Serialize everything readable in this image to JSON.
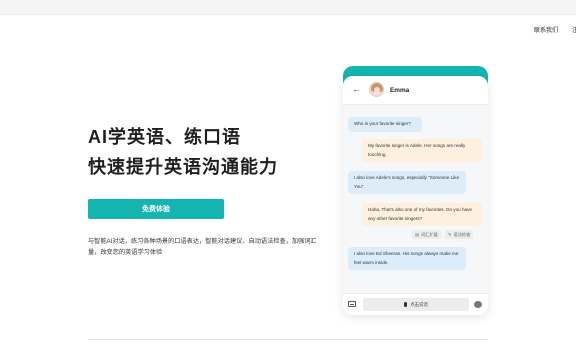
{
  "nav": {
    "contact": "联系我们",
    "edge": "注"
  },
  "hero": {
    "title_line1": "AI学英语、练口语",
    "title_line2": "快速提升英语沟通能力",
    "cta": "免费体验",
    "description": "与智能AI对话，练习各种场景的口语表达，智能对话建议、自动语法检查，加强词汇量，改变您的英语学习体验"
  },
  "chat": {
    "contact_name": "Emma",
    "messages": [
      {
        "role": "bot",
        "text": "Who is your favorite singer?"
      },
      {
        "role": "user",
        "text": "My favorite singer is Adele. Her songs are really touching."
      },
      {
        "role": "bot",
        "text": "I also love Adele's songs, especially \"Someone Like You\"."
      },
      {
        "role": "user",
        "text": "Haha, That's also one of my favorites. Do you have any other favorite singers?"
      },
      {
        "role": "bot",
        "text": "I also love Ed Sheeran. His songs always make me feel warm inside."
      }
    ],
    "chips": [
      "词汇扩展",
      "语法检查"
    ],
    "voice_label": "点击说话"
  },
  "colors": {
    "accent": "#14b4b0",
    "bot_bubble": "#dcecf8",
    "user_bubble": "#fdf0df"
  }
}
